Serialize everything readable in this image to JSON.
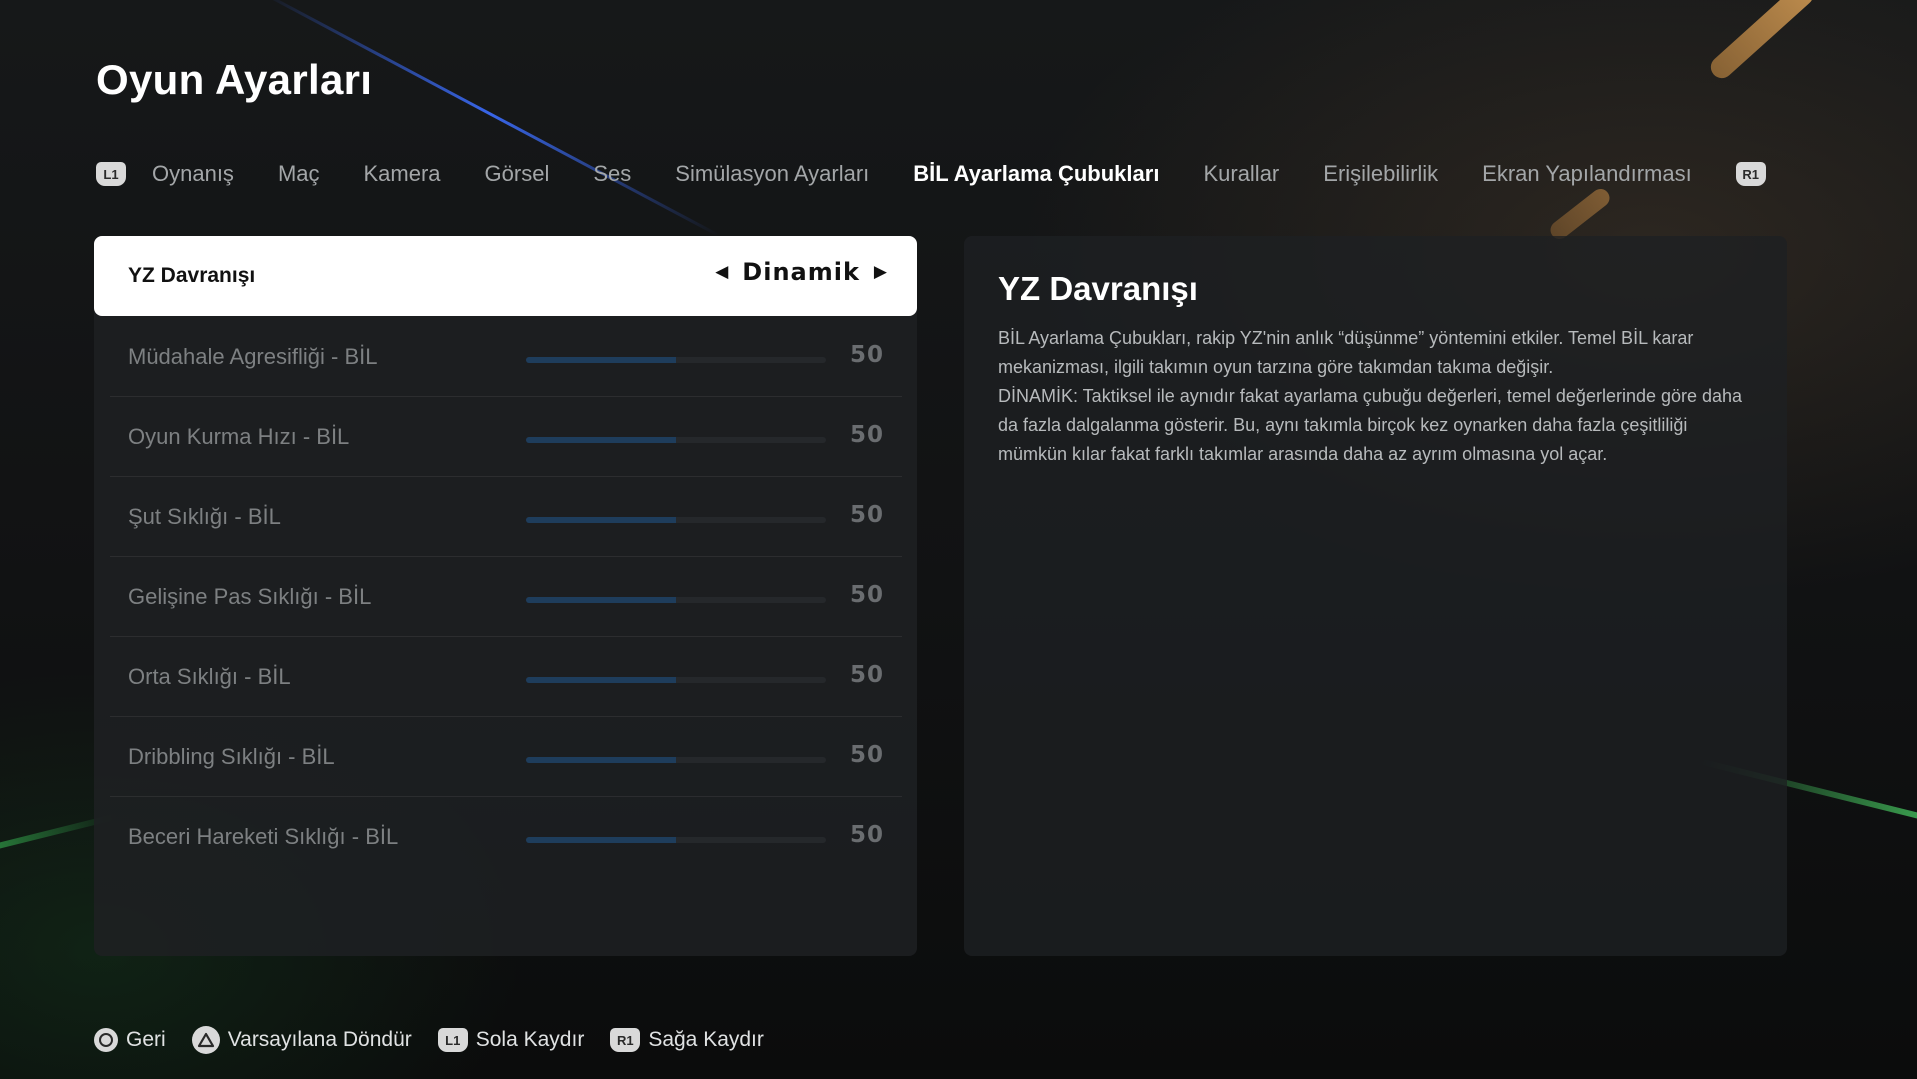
{
  "page": {
    "title": "Oyun Ayarları"
  },
  "tabs": {
    "left_button": "L1",
    "right_button": "R1",
    "items": [
      {
        "label": "Oynanış"
      },
      {
        "label": "Maç"
      },
      {
        "label": "Kamera"
      },
      {
        "label": "Görsel"
      },
      {
        "label": "Ses"
      },
      {
        "label": "Simülasyon Ayarları"
      },
      {
        "label": "BİL Ayarlama Çubukları",
        "active": true
      },
      {
        "label": "Kurallar"
      },
      {
        "label": "Erişilebilirlik"
      },
      {
        "label": "Ekran Yapılandırması"
      }
    ]
  },
  "settings": {
    "selected": {
      "label": "YZ Davranışı",
      "value": "Dinamik"
    },
    "sliders": [
      {
        "label": "Müdahale Agresifliği - BİL",
        "value": 50,
        "fill_fraction": 0.5
      },
      {
        "label": "Oyun Kurma Hızı - BİL",
        "value": 50,
        "fill_fraction": 0.5
      },
      {
        "label": "Şut Sıklığı - BİL",
        "value": 50,
        "fill_fraction": 0.5
      },
      {
        "label": "Gelişine Pas Sıklığı - BİL",
        "value": 50,
        "fill_fraction": 0.5
      },
      {
        "label": "Orta Sıklığı - BİL",
        "value": 50,
        "fill_fraction": 0.5
      },
      {
        "label": "Dribbling Sıklığı - BİL",
        "value": 50,
        "fill_fraction": 0.5
      },
      {
        "label": "Beceri Hareketi Sıklığı - BİL",
        "value": 50,
        "fill_fraction": 0.5
      }
    ]
  },
  "description": {
    "title": "YZ Davranışı",
    "text": "BİL Ayarlama Çubukları, rakip YZ'nin anlık “düşünme” yöntemini etkiler. Temel BİL karar mekanizması, ilgili takımın oyun tarzına göre takımdan takıma değişir.\nDİNAMİK: Taktiksel ile aynıdır fakat ayarlama çubuğu değerleri, temel değerlerinde göre daha da fazla dalgalanma gösterir. Bu, aynı takımla birçok kez oynarken daha fazla çeşitliliği mümkün kılar fakat farklı takımlar arasında daha az ayrım olmasına yol açar."
  },
  "footer": {
    "hints": [
      {
        "icon": "circle-button-icon",
        "label": "Geri"
      },
      {
        "icon": "triangle-button-icon",
        "label": "Varsayılana Döndür"
      },
      {
        "icon": "l1-button-icon",
        "button": "L1",
        "label": "Sola Kaydır"
      },
      {
        "icon": "r1-button-icon",
        "button": "R1",
        "label": "Sağa Kaydır"
      }
    ]
  },
  "colors": {
    "accent_fill": "#1e3d5c",
    "active_tab": "#ffffff",
    "inactive_tab": "#a3a6a8",
    "panel": "#1e2022"
  }
}
